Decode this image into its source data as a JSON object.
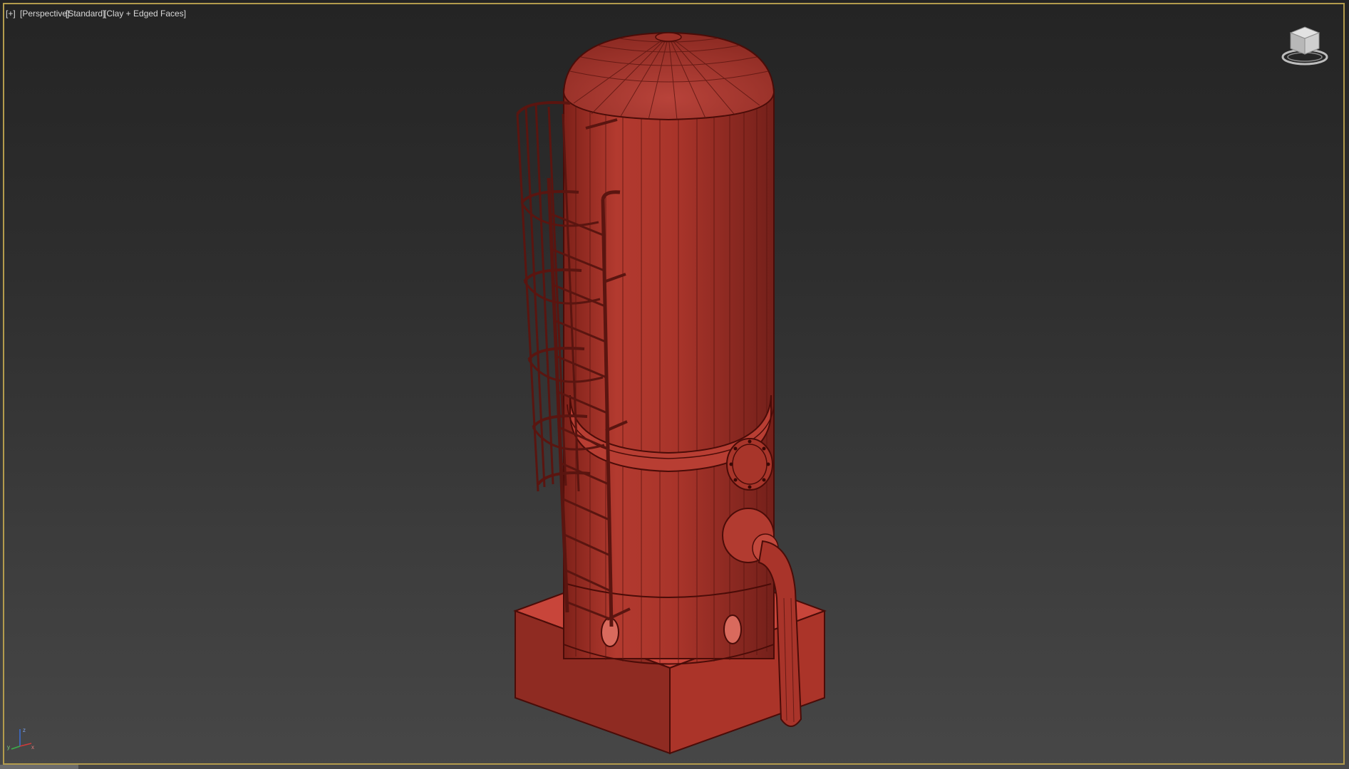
{
  "viewport": {
    "menu_plus": "[+]",
    "view_mode": "[Perspective]",
    "camera_mode": "[Standard]",
    "shading_mode": "[Clay + Edged Faces]",
    "active_border_color": "#b39b4c",
    "background_top": "#242424",
    "background_bottom": "#474747"
  },
  "model": {
    "material_color": "#b8392e",
    "edge_color": "#4a0c08",
    "highlight_color": "#d45a4c"
  },
  "navigation": {
    "viewcube_icon": "viewcube-icon",
    "axis_icon": "axis-tripod-icon",
    "axis_x": "x",
    "axis_y": "y",
    "axis_z": "z"
  }
}
